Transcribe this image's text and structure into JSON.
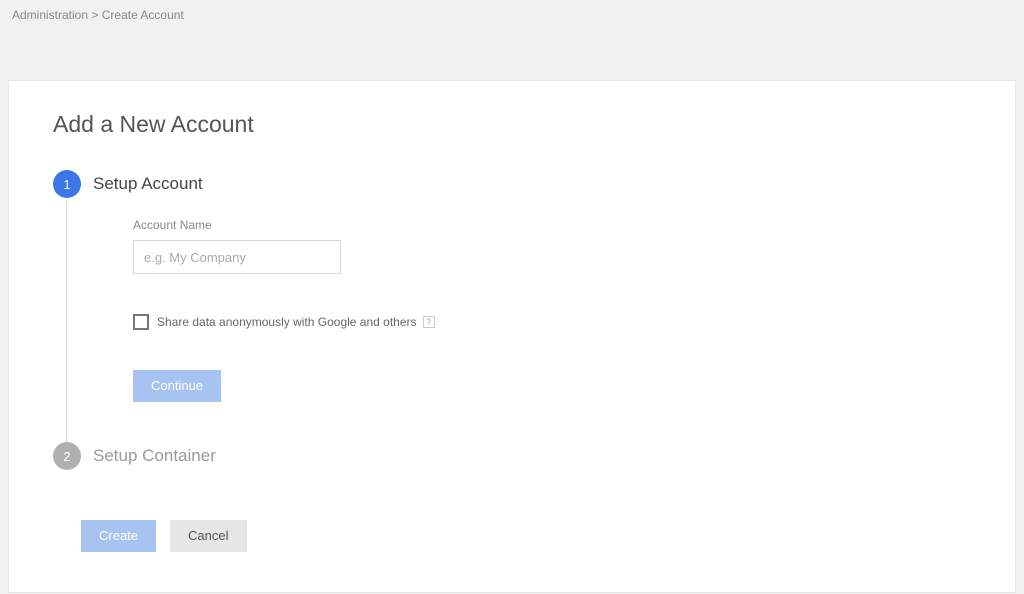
{
  "breadcrumb": {
    "root": "Administration",
    "separator": ">",
    "current": "Create Account"
  },
  "page": {
    "title": "Add a New Account"
  },
  "step1": {
    "number": "1",
    "title": "Setup Account",
    "account_name_label": "Account Name",
    "account_name_placeholder": "e.g. My Company",
    "share_checkbox_label": "Share data anonymously with Google and others",
    "help_glyph": "?",
    "continue_label": "Continue"
  },
  "step2": {
    "number": "2",
    "title": "Setup Container"
  },
  "footer": {
    "create_label": "Create",
    "cancel_label": "Cancel"
  }
}
